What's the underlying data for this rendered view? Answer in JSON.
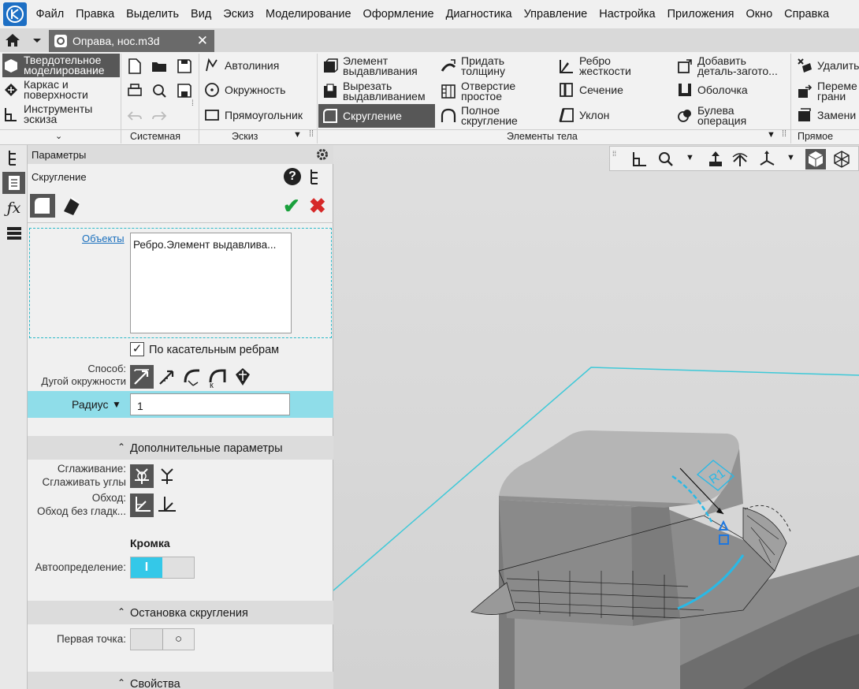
{
  "colors": {
    "accent": "#8fdde9",
    "selected": "#555555",
    "ok": "#1aa03c",
    "cancel": "#d62828",
    "selection_outline": "#2ab8c7"
  },
  "menu": [
    "Файл",
    "Правка",
    "Выделить",
    "Вид",
    "Эскиз",
    "Моделирование",
    "Оформление",
    "Диагностика",
    "Управление",
    "Настройка",
    "Приложения",
    "Окно",
    "Справка"
  ],
  "tab": {
    "title": "Оправа, нос.m3d",
    "close": "✕"
  },
  "ribbon": {
    "modes": [
      {
        "label": "Твердотельное моделирование",
        "l1": "Твердотельное",
        "l2": "моделирование"
      },
      {
        "label": "Каркас и поверхности",
        "l1": "Каркас и",
        "l2": "поверхности"
      },
      {
        "label": "Инструменты эскиза",
        "l1": "Инструменты",
        "l2": "эскиза"
      }
    ],
    "sketch_tools": [
      "Автолиния",
      "Окружность",
      "Прямоугольник"
    ],
    "body_tools": {
      "extrude": [
        "Элемент",
        "выдавливания"
      ],
      "cut_extrude": [
        "Вырезать",
        "выдавливанием"
      ],
      "fillet": "Скругление",
      "thicken": [
        "Придать",
        "толщину"
      ],
      "hole": [
        "Отверстие",
        "простое"
      ],
      "full_fillet": [
        "Полное",
        "скругление"
      ],
      "rib": [
        "Ребро",
        "жесткости"
      ],
      "section": "Сечение",
      "draft": "Уклон",
      "add_blank": [
        "Добавить",
        "деталь-загото..."
      ],
      "shell": "Оболочка",
      "boolean": [
        "Булева",
        "операция"
      ],
      "delete": "Удалить",
      "move_faces": [
        "Переме",
        "грани"
      ],
      "replace": "Замени"
    },
    "groups": {
      "system": "Системная",
      "sketch": "Эскиз",
      "body": "Элементы тела",
      "direct": "Прямое моде"
    }
  },
  "panel": {
    "header": "Параметры",
    "operation": "Скругление",
    "objects_link": "Объекты",
    "objects_value": "Ребро.Элемент выдавлива...",
    "tangent_label": "По касательным ребрам",
    "tangent_checked": true,
    "method_label": "Способ:",
    "method_value": "Дугой окружности",
    "radius_label": "Радиус",
    "radius_value": "1",
    "extra_section": "Дополнительные параметры",
    "smoothing_label": "Сглаживание:",
    "smoothing_value": "Сглаживать углы",
    "bypass_label": "Обход:",
    "bypass_value": "Обход без гладк...",
    "edge_title": "Кромка",
    "auto_label": "Автоопределение:",
    "auto_on_text": "I",
    "auto_enabled": true,
    "stop_section": "Остановка скругления",
    "first_point_label": "Первая точка:",
    "first_point_enabled": false,
    "properties_section": "Свойства"
  },
  "viewport": {
    "dimension_label": "R1"
  }
}
